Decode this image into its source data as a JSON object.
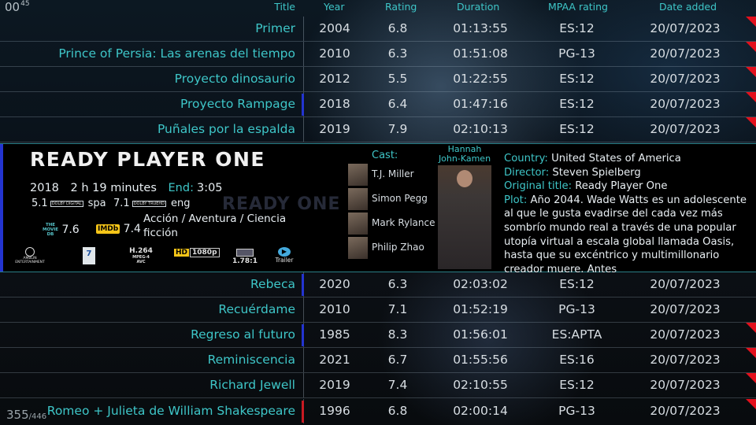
{
  "clock": {
    "main": "00",
    "small": "45"
  },
  "counter": {
    "current": "355",
    "total": "/446"
  },
  "columns": {
    "title": "Title",
    "year": "Year",
    "rating": "Rating",
    "duration": "Duration",
    "mpaa": "MPAA rating",
    "date_added": "Date added"
  },
  "rows_top": [
    {
      "title": "Primer",
      "year": "2004",
      "rating": "6.8",
      "duration": "01:13:55",
      "mpaa": "ES:12",
      "date": "20/07/2023"
    },
    {
      "title": "Prince of Persia: Las arenas del tiempo",
      "year": "2010",
      "rating": "6.3",
      "duration": "01:51:08",
      "mpaa": "PG-13",
      "date": "20/07/2023"
    },
    {
      "title": "Proyecto dinosaurio",
      "year": "2012",
      "rating": "5.5",
      "duration": "01:22:55",
      "mpaa": "ES:12",
      "date": "20/07/2023"
    },
    {
      "title": "Proyecto Rampage",
      "year": "2018",
      "rating": "6.4",
      "duration": "01:47:16",
      "mpaa": "ES:12",
      "date": "20/07/2023"
    },
    {
      "title": "Puñales por la espalda",
      "year": "2019",
      "rating": "7.9",
      "duration": "02:10:13",
      "mpaa": "ES:12",
      "date": "20/07/2023"
    }
  ],
  "rows_bottom": [
    {
      "title": "Rebeca",
      "year": "2020",
      "rating": "6.3",
      "duration": "02:03:02",
      "mpaa": "ES:12",
      "date": "20/07/2023"
    },
    {
      "title": "Recuérdame",
      "year": "2010",
      "rating": "7.1",
      "duration": "01:52:19",
      "mpaa": "PG-13",
      "date": "20/07/2023"
    },
    {
      "title": "Regreso al futuro",
      "year": "1985",
      "rating": "8.3",
      "duration": "01:56:01",
      "mpaa": "ES:APTA",
      "date": "20/07/2023"
    },
    {
      "title": "Reminiscencia",
      "year": "2021",
      "rating": "6.7",
      "duration": "01:55:56",
      "mpaa": "ES:16",
      "date": "20/07/2023"
    },
    {
      "title": "Richard Jewell",
      "year": "2019",
      "rating": "7.4",
      "duration": "02:10:55",
      "mpaa": "ES:12",
      "date": "20/07/2023"
    },
    {
      "title": "Romeo + Julieta de William Shakespeare",
      "year": "1996",
      "rating": "6.8",
      "duration": "02:00:14",
      "mpaa": "PG-13",
      "date": "20/07/2023"
    }
  ],
  "selected": {
    "title": "READY PLAYER ONE",
    "ghost_logo": "READY ONE",
    "year": "2018",
    "runtime": "2 h 19 minutes",
    "end_label": "End:",
    "end_time": "3:05",
    "audio1_channels": "5.1",
    "audio1_codec": "DOLBY DIGITAL",
    "audio1_lang": "spa",
    "audio2_channels": "7.1",
    "audio2_codec": "DOLBY TRUEHD",
    "audio2_lang": "eng",
    "genres": "Acción / Aventura / Ciencia ficción",
    "tmdb_label": "THE MOVIE DB",
    "tmdb_score": "7.6",
    "imdb_label": "IMDb",
    "imdb_score": "7.4",
    "studio": "AMBLIN ENTERTAINMENT",
    "age_rating": "7",
    "video_codec": "H.264",
    "video_codec_sub": "MPEG-4 AVC",
    "hd_label": "HD",
    "resolution": "1080p",
    "aspect": "1.78:1",
    "trailer_label": "Trailer",
    "cast_label": "Cast:",
    "cast": [
      "T.J. Miller",
      "Simon Pegg",
      "Mark Rylance",
      "Philip Zhao"
    ],
    "featured_actor": "Hannah John-Kamen",
    "country_label": "Country:",
    "country": "United States of America",
    "director_label": "Director:",
    "director": "Steven Spielberg",
    "original_label": "Original title:",
    "original_title": "Ready Player One",
    "plot_label": "Plot:",
    "plot": "Año 2044. Wade Watts es un adolescente al que le gusta evadirse del cada vez más sombrío mundo real a través de una popular utopía virtual a escala global llamada Oasis, hasta que su excéntrico y multimillonario creador muere. Antes"
  },
  "colors": {
    "accent": "#3ec6c8",
    "watched_marker": "#e3101c",
    "selection_bar": "#2334d0"
  }
}
